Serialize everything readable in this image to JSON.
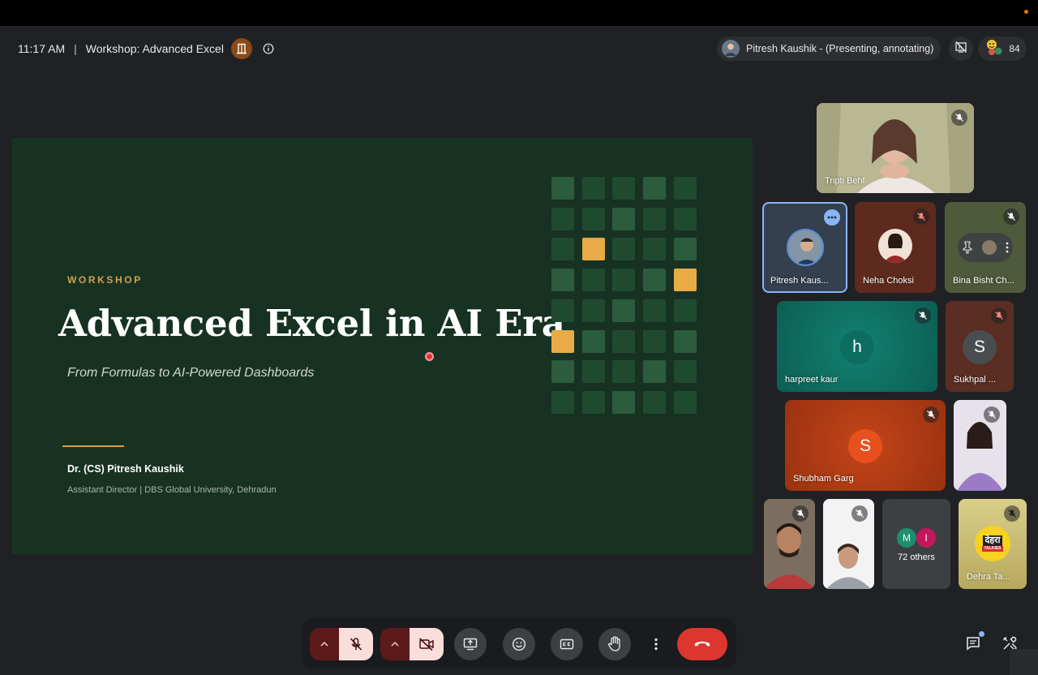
{
  "header": {
    "time": "11:17 AM",
    "separator": "|",
    "meeting_title": "Workshop: Advanced Excel",
    "presenter_status": "Pitresh Kaushik - (Presenting, annotating)",
    "participant_count": "84"
  },
  "slide": {
    "kicker": "WORKSHOP",
    "title": "Advanced Excel in AI Era",
    "subtitle": "From Formulas to AI-Powered Dashboards",
    "author": "Dr. (CS) Pitresh Kaushik",
    "affiliation": "Assistant Director  |  DBS Global University, Dehradun",
    "colors": {
      "background": "#173222",
      "accent": "#d4a24a"
    }
  },
  "participants": [
    {
      "name": "Tripti Behl",
      "muted": true,
      "video": true
    },
    {
      "name": "Pitresh Kaus...",
      "muted": false,
      "video": false,
      "active": true
    },
    {
      "name": "Neha Choksi",
      "muted": true,
      "video": false
    },
    {
      "name": "Bina Bisht Ch...",
      "muted": true,
      "video": false
    },
    {
      "name": "harpreet kaur",
      "initial": "h",
      "muted": true
    },
    {
      "name": "Sukhpal ...",
      "initial": "S",
      "muted": true
    },
    {
      "name": "Shubham Garg",
      "initial": "S",
      "muted": true
    },
    {
      "name": "",
      "muted": true,
      "video": true
    },
    {
      "name": "",
      "muted": true,
      "video": true
    },
    {
      "name": "",
      "muted": true,
      "video": true
    },
    {
      "name": "72 others",
      "initials": [
        "M",
        "I"
      ]
    },
    {
      "name": "Dehra Ta...",
      "muted": true,
      "logo_text": [
        "देहरा",
        "TALKIES"
      ]
    }
  ],
  "controls": {
    "items": [
      "mic-toggle",
      "camera-toggle",
      "present-screen",
      "reactions",
      "captions",
      "raise-hand",
      "more-options",
      "leave-call"
    ]
  }
}
